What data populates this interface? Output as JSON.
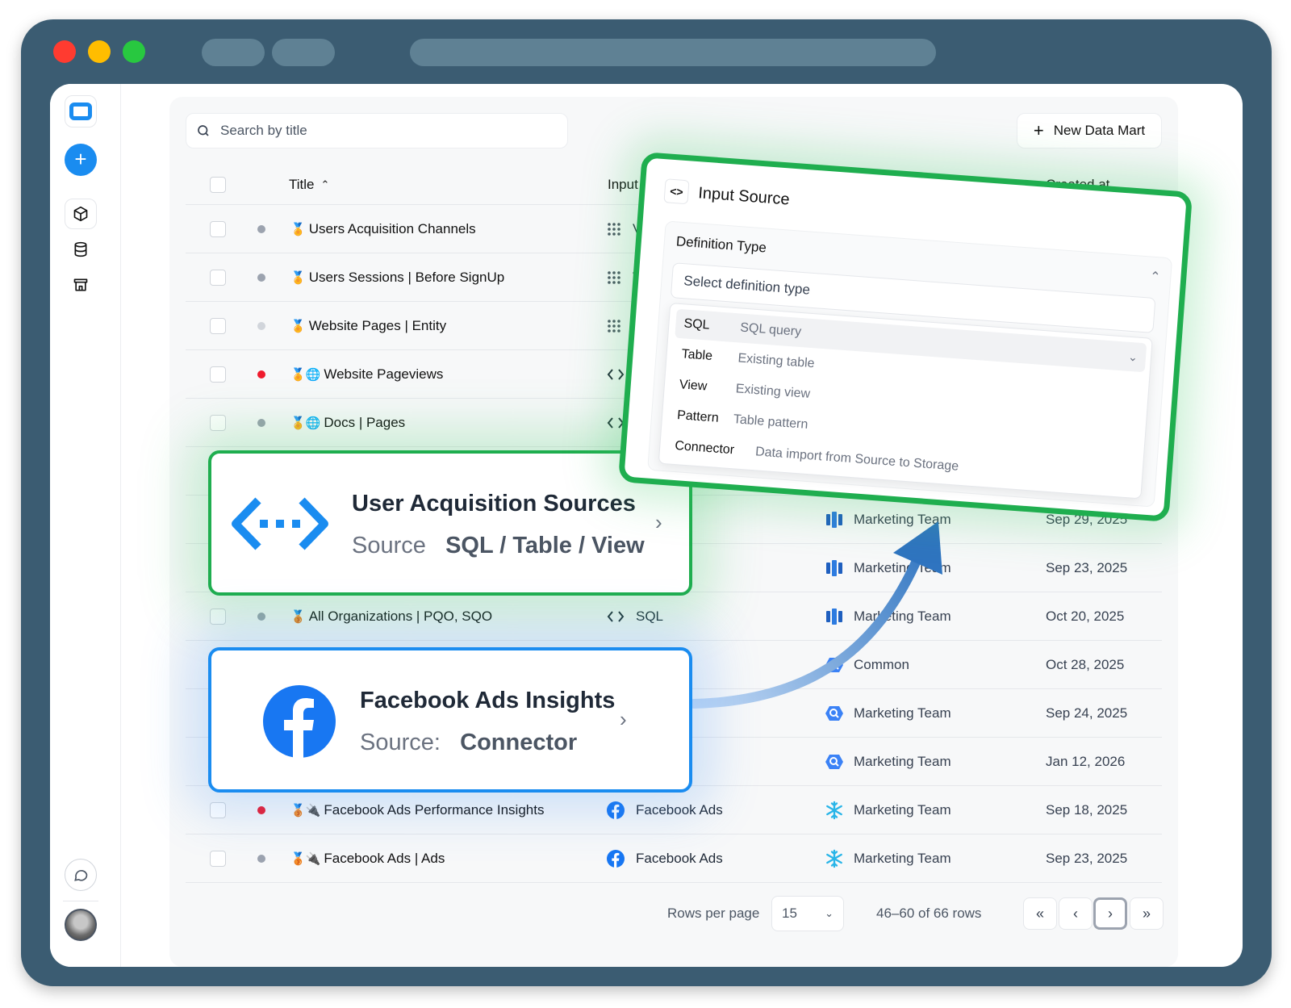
{
  "search": {
    "placeholder": "Search by title"
  },
  "toolbar": {
    "new_label": "New Data Mart"
  },
  "table": {
    "headers": {
      "title": "Title",
      "input_source": "Input Sc",
      "created_at": "Created at"
    },
    "rows": [
      {
        "title": "Users Acquisition Channels",
        "prefix": "🏅",
        "status": "gray",
        "source": "Viey",
        "source_icon": "grid-icon",
        "storage": "",
        "date": ""
      },
      {
        "title": "Users Sessions | Before SignUp",
        "prefix": "🏅",
        "status": "gray",
        "source": "Vie",
        "source_icon": "grid-icon",
        "storage": "",
        "date": ""
      },
      {
        "title": "Website Pages | Entity",
        "prefix": "🏅",
        "status": "light",
        "source": "Vi",
        "source_icon": "grid-icon",
        "storage": "",
        "date": ""
      },
      {
        "title": "Website Pageviews",
        "prefix": "🏅🌐",
        "status": "red",
        "source": "S",
        "source_icon": "code-icon",
        "storage": "",
        "date": ""
      },
      {
        "title": "Docs | Pages",
        "prefix": "🏅🌐",
        "status": "gray",
        "source": "",
        "source_icon": "code-icon",
        "storage": "",
        "date": ""
      },
      {
        "title": "",
        "prefix": "",
        "status": "",
        "source": "",
        "source_icon": "",
        "storage": "",
        "date": ""
      },
      {
        "title": "",
        "prefix": "",
        "status": "",
        "source": "",
        "source_icon": "",
        "storage": "Marketing Team",
        "storage_icon": "redshift-icon",
        "date": "Sep 29, 2025"
      },
      {
        "title": "",
        "prefix": "",
        "status": "",
        "source": "Ads",
        "source_icon": "",
        "storage": "Marketing Team",
        "storage_icon": "redshift-icon",
        "date": "Sep 23, 2025"
      },
      {
        "title": "All Organizations | PQO, SQO",
        "prefix": "🥉",
        "status": "gray",
        "source": "SQL",
        "source_icon": "code-icon",
        "storage": "Marketing Team",
        "storage_icon": "redshift-icon",
        "date": "Oct 20, 2025"
      },
      {
        "title": "",
        "prefix": "",
        "status": "",
        "source": "",
        "source_icon": "",
        "storage": "Common",
        "storage_icon": "bigquery-icon",
        "date": "Oct 28, 2025"
      },
      {
        "title": "",
        "prefix": "",
        "status": "",
        "source": "",
        "source_icon": "",
        "storage": "Marketing Team",
        "storage_icon": "bigquery-icon",
        "date": "Sep 24, 2025"
      },
      {
        "title": "",
        "prefix": "",
        "status": "",
        "source": "Ads",
        "source_icon": "",
        "storage": "Marketing Team",
        "storage_icon": "bigquery-icon",
        "date": "Jan 12, 2026"
      },
      {
        "title": "Facebook Ads Performance Insights",
        "prefix": "🥉🔌",
        "status": "red",
        "source": "Facebook Ads",
        "source_icon": "facebook-icon",
        "storage": "Marketing Team",
        "storage_icon": "snowflake-icon",
        "date": "Sep 18, 2025"
      },
      {
        "title": "Facebook Ads | Ads",
        "prefix": "🥉🔌",
        "status": "gray",
        "source": "Facebook Ads",
        "source_icon": "facebook-icon",
        "storage": "Marketing Team",
        "storage_icon": "snowflake-icon",
        "date": "Sep 23, 2025"
      }
    ]
  },
  "pagination": {
    "rows_per_page_label": "Rows per page",
    "rows_per_page_value": "15",
    "range_text": "46–60 of 66 rows"
  },
  "callout_sql": {
    "title": "User Acquisition Sources",
    "key": "Source",
    "value": "SQL / Table / View"
  },
  "callout_fb": {
    "title": "Facebook Ads Insights",
    "key": "Source:",
    "value": "Connector"
  },
  "popup": {
    "title": "Input Source",
    "definition_label": "Definition Type",
    "select_placeholder": "Select definition type",
    "options": [
      {
        "key": "SQL",
        "desc": "SQL query"
      },
      {
        "key": "Table",
        "desc": "Existing table"
      },
      {
        "key": "View",
        "desc": "Existing view"
      },
      {
        "key": "Pattern",
        "desc": "Table pattern"
      },
      {
        "key": "Connector",
        "desc": "Data import from Source to Storage"
      }
    ]
  },
  "colors": {
    "accent": "#1a8cf0",
    "highlight_green": "#1fae4f",
    "frame": "#3b5c72",
    "status_red": "#ef1b2d"
  }
}
